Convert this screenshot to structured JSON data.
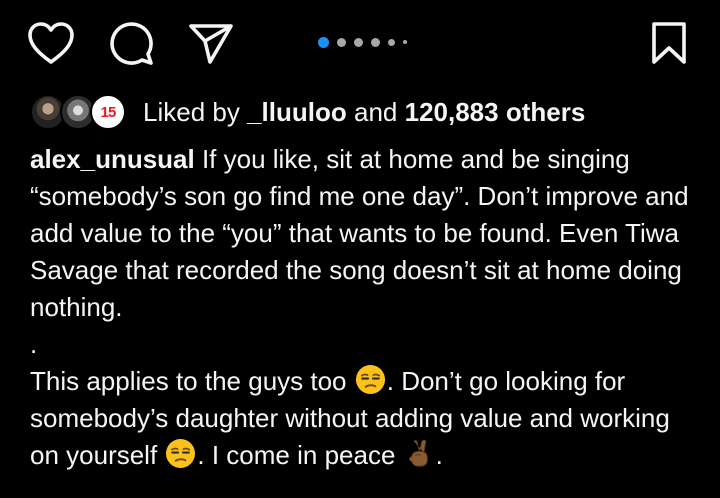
{
  "action_bar": {
    "icons": {
      "like": "heart-outline-icon",
      "comment": "comment-bubble-icon",
      "share": "paper-plane-icon",
      "save": "bookmark-outline-icon"
    },
    "carousel": {
      "total_dots": 6,
      "active_index": 0,
      "active_color": "#1e8ff5",
      "inactive_color": "#a8a8a8"
    }
  },
  "likes": {
    "prefix": "Liked by",
    "user": "_lluuloo",
    "connector": "and",
    "count": "120,883 others",
    "avatar_logo_text": "15"
  },
  "caption": {
    "username": "alex_unusual",
    "paragraph1": " If you like, sit at home and be singing “somebody’s son go find me one day”. Don’t improve and add value to the “you” that wants to be found. Even Tiwa Savage that recorded the song doesn’t sit at home doing nothing.",
    "separator": ".",
    "p2_part1": "This applies to the guys too ",
    "p2_part2": ". Don’t go looking for somebody’s daughter without adding value and working on yourself ",
    "p2_part3": ". I come in peace ",
    "p2_part4": ".",
    "emojis": {
      "unamused": "unamused-face-emoji",
      "victory": "victory-hand-emoji"
    }
  },
  "colors": {
    "background": "#000000",
    "text": "#f5f5f5"
  }
}
